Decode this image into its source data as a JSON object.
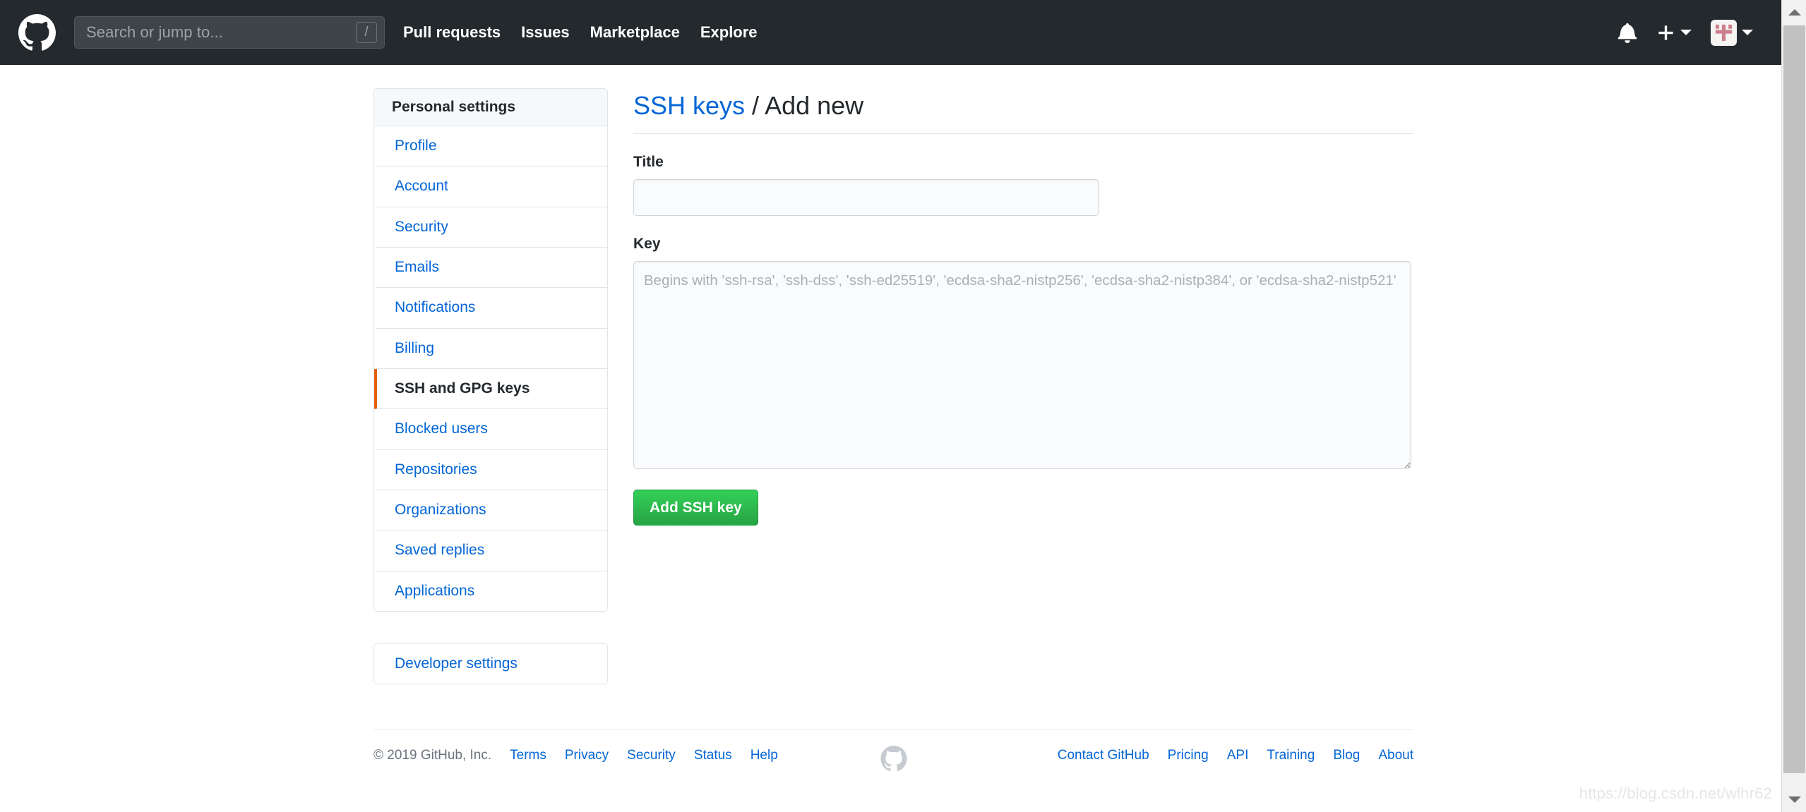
{
  "header": {
    "logo_icon": "github-mark-icon",
    "search": {
      "placeholder": "Search or jump to...",
      "value": "",
      "shortcut": "/"
    },
    "nav": [
      {
        "label": "Pull requests"
      },
      {
        "label": "Issues"
      },
      {
        "label": "Marketplace"
      },
      {
        "label": "Explore"
      }
    ],
    "icons": {
      "notifications": "bell-icon",
      "create_new": "plus-icon",
      "create_new_caret": "chevron-down-icon",
      "avatar": "user-avatar-identicon",
      "avatar_caret": "chevron-down-icon"
    }
  },
  "sidebar": {
    "heading": "Personal settings",
    "items": [
      {
        "label": "Profile",
        "selected": false
      },
      {
        "label": "Account",
        "selected": false
      },
      {
        "label": "Security",
        "selected": false
      },
      {
        "label": "Emails",
        "selected": false
      },
      {
        "label": "Notifications",
        "selected": false
      },
      {
        "label": "Billing",
        "selected": false
      },
      {
        "label": "SSH and GPG keys",
        "selected": true
      },
      {
        "label": "Blocked users",
        "selected": false
      },
      {
        "label": "Repositories",
        "selected": false
      },
      {
        "label": "Organizations",
        "selected": false
      },
      {
        "label": "Saved replies",
        "selected": false
      },
      {
        "label": "Applications",
        "selected": false
      }
    ],
    "developer_settings": "Developer settings"
  },
  "main": {
    "title_link": "SSH keys",
    "title_rest": " / Add new",
    "fields": {
      "title_label": "Title",
      "title_value": "",
      "title_placeholder": "",
      "key_label": "Key",
      "key_value": "",
      "key_placeholder": "Begins with 'ssh-rsa', 'ssh-dss', 'ssh-ed25519', 'ecdsa-sha2-nistp256', 'ecdsa-sha2-nistp384', or 'ecdsa-sha2-nistp521'"
    },
    "submit_label": "Add SSH key"
  },
  "footer": {
    "copyright": "© 2019 GitHub, Inc.",
    "left_links": [
      {
        "label": "Terms"
      },
      {
        "label": "Privacy"
      },
      {
        "label": "Security"
      },
      {
        "label": "Status"
      },
      {
        "label": "Help"
      }
    ],
    "mark_icon": "github-mark-icon",
    "right_links": [
      {
        "label": "Contact GitHub"
      },
      {
        "label": "Pricing"
      },
      {
        "label": "API"
      },
      {
        "label": "Training"
      },
      {
        "label": "Blog"
      },
      {
        "label": "About"
      }
    ]
  },
  "watermark": {
    "text": "https://blog.csdn.net/wlhr62"
  },
  "colors": {
    "header_bg": "#24292e",
    "link_blue": "#0366d6",
    "selected_accent": "#e36209",
    "button_green": "#28a745",
    "text_dark": "#24292e",
    "muted": "#6a737d",
    "border": "#e1e4e8"
  }
}
